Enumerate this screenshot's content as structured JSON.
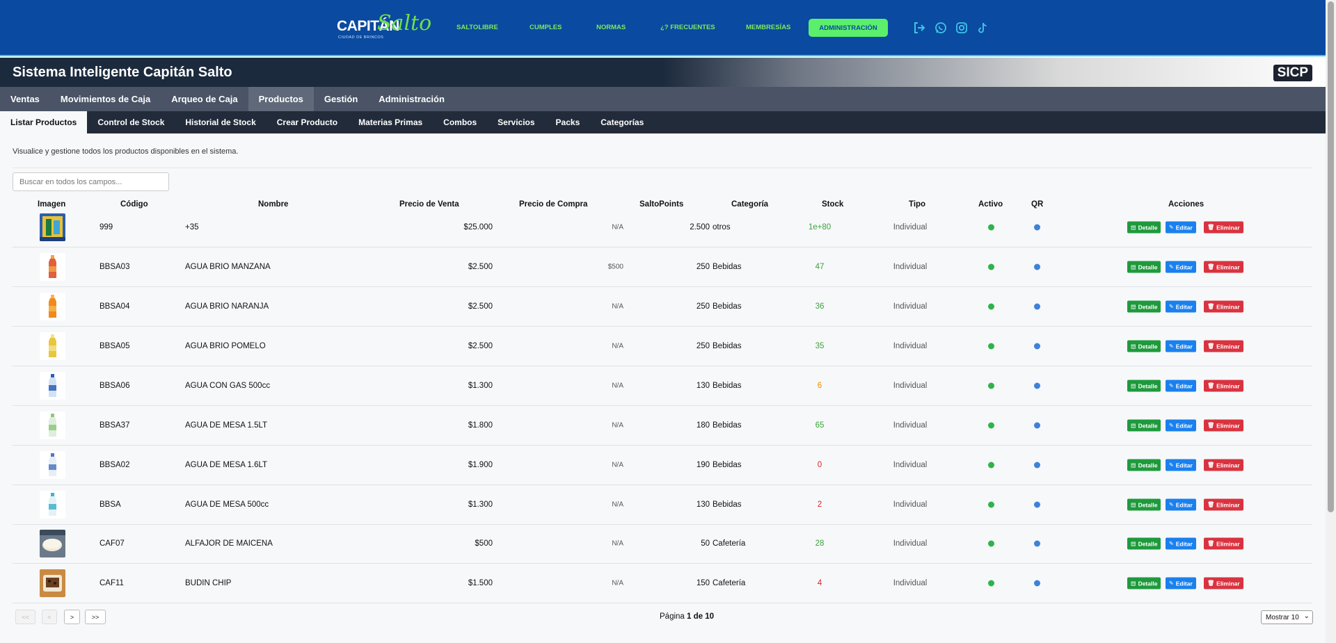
{
  "brand": {
    "name_part1": "CAPITÁN",
    "name_part2": "Salto",
    "tagline": "CIUDAD DE BRINCOS"
  },
  "topnav": [
    "SALTOLIBRE",
    "CUMPLES",
    "NORMAS",
    "¿? FRECUENTES",
    "MEMBRESÍAS"
  ],
  "admin_button": "ADMINISTRACIÓN",
  "system_title": "Sistema Inteligente Capitán Salto",
  "system_badge": "SICP",
  "main_menu": [
    "Ventas",
    "Movimientos de Caja",
    "Arqueo de Caja",
    "Productos",
    "Gestión",
    "Administración"
  ],
  "main_menu_active": "Productos",
  "sub_menu": [
    "Listar Productos",
    "Control de Stock",
    "Historial de Stock",
    "Crear Producto",
    "Materias Primas",
    "Combos",
    "Servicios",
    "Packs",
    "Categorías"
  ],
  "sub_menu_active": "Listar Productos",
  "description": "Visualice y gestione todos los productos disponibles en el sistema.",
  "search": {
    "placeholder": "Buscar en todos los campos..."
  },
  "columns": [
    "Imagen",
    "Código",
    "Nombre",
    "Precio de Venta",
    "Precio de Compra",
    "SaltoPoints",
    "Categoría",
    "Stock",
    "Tipo",
    "Activo",
    "QR",
    "Acciones"
  ],
  "actions": {
    "detail": "Detalle",
    "edit": "Editar",
    "delete": "Eliminar"
  },
  "products": [
    {
      "code": "999",
      "name": "+35",
      "sale_price": "$25.000",
      "purchase_price": "N/A",
      "points": "2.500",
      "category": "otros",
      "stock": "1e+80",
      "stock_status": "ok",
      "type": "Individual",
      "image": "poster"
    },
    {
      "code": "BBSA03",
      "name": "AGUA BRIO MANZANA",
      "sale_price": "$2.500",
      "purchase_price": "$500",
      "points": "250",
      "category": "Bebidas",
      "stock": "47",
      "stock_status": "ok",
      "type": "Individual",
      "image": "bottle-red"
    },
    {
      "code": "BBSA04",
      "name": "AGUA BRIO NARANJA",
      "sale_price": "$2.500",
      "purchase_price": "N/A",
      "points": "250",
      "category": "Bebidas",
      "stock": "36",
      "stock_status": "ok",
      "type": "Individual",
      "image": "bottle-orange"
    },
    {
      "code": "BBSA05",
      "name": "AGUA BRIO POMELO",
      "sale_price": "$2.500",
      "purchase_price": "N/A",
      "points": "250",
      "category": "Bebidas",
      "stock": "35",
      "stock_status": "ok",
      "type": "Individual",
      "image": "bottle-yellow"
    },
    {
      "code": "BBSA06",
      "name": "AGUA CON GAS 500cc",
      "sale_price": "$1.300",
      "purchase_price": "N/A",
      "points": "130",
      "category": "Bebidas",
      "stock": "6",
      "stock_status": "low",
      "type": "Individual",
      "image": "bottle-blue"
    },
    {
      "code": "BBSA37",
      "name": "AGUA DE MESA 1.5LT",
      "sale_price": "$1.800",
      "purchase_price": "N/A",
      "points": "180",
      "category": "Bebidas",
      "stock": "65",
      "stock_status": "ok",
      "type": "Individual",
      "image": "bottle-green"
    },
    {
      "code": "BBSA02",
      "name": "AGUA DE MESA 1.6LT",
      "sale_price": "$1.900",
      "purchase_price": "N/A",
      "points": "190",
      "category": "Bebidas",
      "stock": "0",
      "stock_status": "critical",
      "type": "Individual",
      "image": "bottle-clear"
    },
    {
      "code": "BBSA",
      "name": "AGUA DE MESA 500cc",
      "sale_price": "$1.300",
      "purchase_price": "N/A",
      "points": "130",
      "category": "Bebidas",
      "stock": "2",
      "stock_status": "critical",
      "type": "Individual",
      "image": "bottle-teal"
    },
    {
      "code": "CAF07",
      "name": "ALFAJOR DE MAICENA",
      "sale_price": "$500",
      "purchase_price": "N/A",
      "points": "50",
      "category": "Cafetería",
      "stock": "28",
      "stock_status": "ok",
      "type": "Individual",
      "image": "alfajor"
    },
    {
      "code": "CAF11",
      "name": "BUDIN CHIP",
      "sale_price": "$1.500",
      "purchase_price": "N/A",
      "points": "150",
      "category": "Cafetería",
      "stock": "4",
      "stock_status": "critical",
      "type": "Individual",
      "image": "budin"
    }
  ],
  "status_colors": {
    "ok": "#3aa33a",
    "low": "#f08a00",
    "critical": "#e02020",
    "active_dot": "#2fb34a",
    "qr_dot": "#3d82d9"
  },
  "pagination": {
    "first": "<<",
    "prev": "<",
    "next": ">",
    "last": ">>",
    "label": "Página",
    "current": "1",
    "of": "de",
    "total": "10",
    "per_page": "Mostrar 10"
  }
}
